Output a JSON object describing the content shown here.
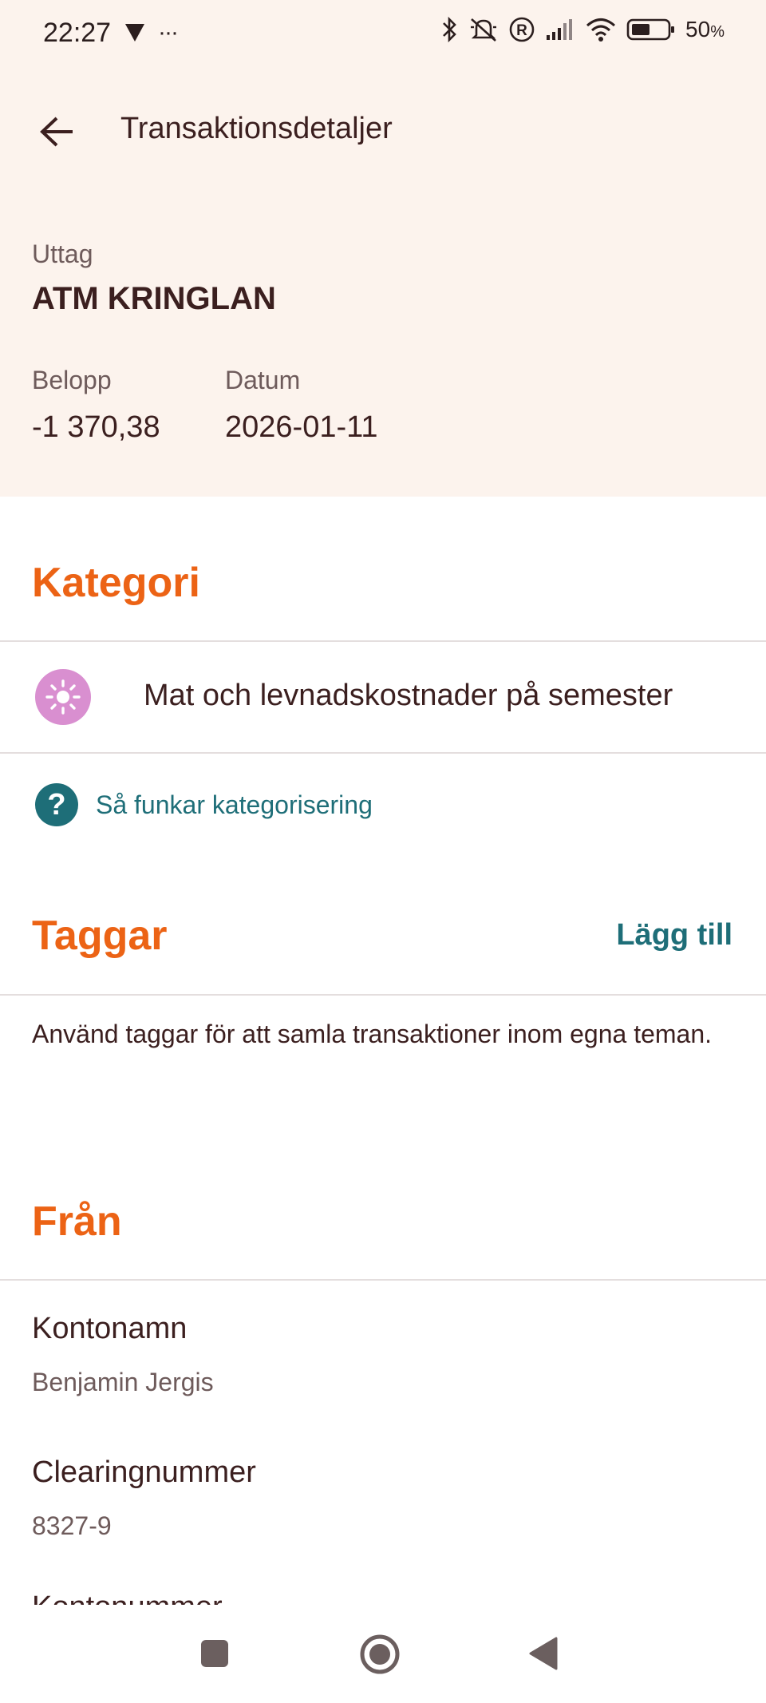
{
  "status_bar": {
    "time": "22:27",
    "dots": "···",
    "battery_percent": "50",
    "battery_unit": "%"
  },
  "app_bar": {
    "title": "Transaktionsdetaljer"
  },
  "transaction": {
    "type": "Uttag",
    "merchant": "ATM KRINGLAN",
    "amount_label": "Belopp",
    "amount": "-1 370,38",
    "date_label": "Datum",
    "date": "2026-01-11"
  },
  "category": {
    "title": "Kategori",
    "name": "Mat och levnadskostnader på semester",
    "icon": "sun-icon",
    "icon_color": "#d98fd0",
    "help_link": "Så funkar kategorisering"
  },
  "tags": {
    "title": "Taggar",
    "add_label": "Lägg till",
    "description": "Använd taggar för att samla transaktioner inom egna teman."
  },
  "from": {
    "title": "Från",
    "fields": [
      {
        "label": "Kontonamn",
        "value": "Benjamin Jergis"
      },
      {
        "label": "Clearingnummer",
        "value": "8327-9"
      },
      {
        "label": "Kontonummer"
      }
    ]
  },
  "colors": {
    "accent_orange": "#ec6315",
    "link_teal": "#1e6e78",
    "header_bg": "#fcf3ed",
    "text_dark": "#3b1f1f"
  }
}
